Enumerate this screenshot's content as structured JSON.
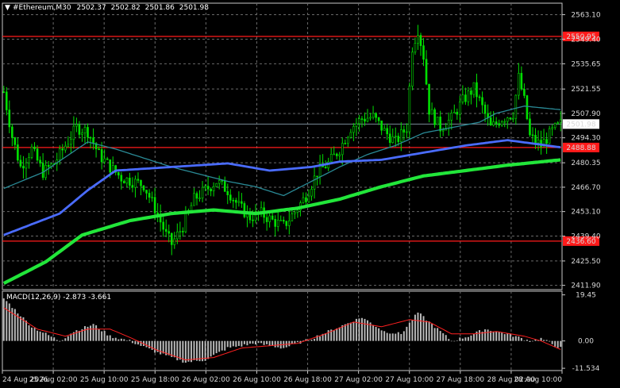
{
  "chart_data": {
    "type": "candlestick",
    "header": {
      "symbol": "#Ethereum,M30",
      "open": "2502.37",
      "high": "2502.82",
      "low": "2501.86",
      "close": "2501.98"
    },
    "y_ticks": [
      "2563.10",
      "2549.40",
      "2535.65",
      "2521.55",
      "2507.90",
      "2494.30",
      "2480.35",
      "2466.70",
      "2453.10",
      "2439.40",
      "2425.50",
      "2411.90"
    ],
    "y_range": [
      2409.5,
      2569.5
    ],
    "x_ticks": [
      "24 Aug 2026",
      "25 Aug 02:00",
      "25 Aug 10:00",
      "25 Aug 18:00",
      "26 Aug 02:00",
      "26 Aug 10:00",
      "26 Aug 18:00",
      "27 Aug 02:00",
      "27 Aug 10:00",
      "27 Aug 18:00",
      "28 Aug 02:00",
      "28 Aug 10:00"
    ],
    "levels": [
      {
        "value": 2550.95,
        "label": "2550.95",
        "color": "#ff1a1a"
      },
      {
        "value": 2488.88,
        "label": "2488.88",
        "color": "#ff1a1a"
      },
      {
        "value": 2436.6,
        "label": "2436.60",
        "color": "#ff1a1a"
      }
    ],
    "current_price": {
      "value": 2501.98,
      "label": "2501.98"
    },
    "price_path": [
      [
        0,
        2520
      ],
      [
        3,
        2495
      ],
      [
        6,
        2478
      ],
      [
        10,
        2488
      ],
      [
        14,
        2475
      ],
      [
        18,
        2480
      ],
      [
        22,
        2490
      ],
      [
        26,
        2500
      ],
      [
        30,
        2498
      ],
      [
        34,
        2485
      ],
      [
        38,
        2478
      ],
      [
        42,
        2472
      ],
      [
        46,
        2470
      ],
      [
        50,
        2468
      ],
      [
        54,
        2455
      ],
      [
        58,
        2440
      ],
      [
        60,
        2435
      ],
      [
        64,
        2445
      ],
      [
        68,
        2460
      ],
      [
        72,
        2465
      ],
      [
        76,
        2470
      ],
      [
        80,
        2465
      ],
      [
        84,
        2456
      ],
      [
        88,
        2450
      ],
      [
        92,
        2452
      ],
      [
        96,
        2448
      ],
      [
        100,
        2445
      ],
      [
        104,
        2453
      ],
      [
        108,
        2462
      ],
      [
        112,
        2475
      ],
      [
        116,
        2480
      ],
      [
        120,
        2488
      ],
      [
        124,
        2500
      ],
      [
        128,
        2505
      ],
      [
        132,
        2506
      ],
      [
        136,
        2498
      ],
      [
        140,
        2492
      ],
      [
        144,
        2500
      ],
      [
        146,
        2545
      ],
      [
        148,
        2555
      ],
      [
        150,
        2540
      ],
      [
        152,
        2510
      ],
      [
        156,
        2500
      ],
      [
        160,
        2505
      ],
      [
        164,
        2515
      ],
      [
        168,
        2522
      ],
      [
        170,
        2515
      ],
      [
        174,
        2500
      ],
      [
        178,
        2505
      ],
      [
        182,
        2508
      ],
      [
        184,
        2528
      ],
      [
        186,
        2515
      ],
      [
        188,
        2495
      ],
      [
        192,
        2490
      ],
      [
        196,
        2498
      ],
      [
        199,
        2502
      ]
    ],
    "ma_fast": [
      [
        0,
        2466
      ],
      [
        14,
        2475
      ],
      [
        30,
        2492
      ],
      [
        40,
        2488
      ],
      [
        60,
        2478
      ],
      [
        80,
        2470
      ],
      [
        90,
        2467
      ],
      [
        100,
        2462
      ],
      [
        110,
        2470
      ],
      [
        120,
        2478
      ],
      [
        130,
        2485
      ],
      [
        140,
        2490
      ],
      [
        150,
        2497
      ],
      [
        160,
        2500
      ],
      [
        170,
        2503
      ],
      [
        176,
        2508
      ],
      [
        186,
        2512
      ],
      [
        199,
        2510
      ]
    ],
    "ma_mid": [
      [
        0,
        2440
      ],
      [
        20,
        2452
      ],
      [
        30,
        2465
      ],
      [
        40,
        2476
      ],
      [
        60,
        2478
      ],
      [
        80,
        2480
      ],
      [
        95,
        2476
      ],
      [
        110,
        2478
      ],
      [
        120,
        2481
      ],
      [
        135,
        2482
      ],
      [
        150,
        2486
      ],
      [
        165,
        2490
      ],
      [
        180,
        2493
      ],
      [
        199,
        2489
      ]
    ],
    "ma_slow": [
      [
        0,
        2413
      ],
      [
        15,
        2425
      ],
      [
        28,
        2440
      ],
      [
        45,
        2448
      ],
      [
        60,
        2452
      ],
      [
        75,
        2454
      ],
      [
        90,
        2452
      ],
      [
        105,
        2455
      ],
      [
        120,
        2460
      ],
      [
        135,
        2467
      ],
      [
        150,
        2473
      ],
      [
        165,
        2476
      ],
      [
        180,
        2479
      ],
      [
        199,
        2482
      ]
    ],
    "macd": {
      "label": "MACD(12,26,9) -2.873 -3.661",
      "y_ticks": [
        "19.45",
        "0.00",
        "-11.534"
      ],
      "range": [
        -12.5,
        21
      ],
      "hist": [
        [
          0,
          18
        ],
        [
          10,
          6
        ],
        [
          20,
          0
        ],
        [
          25,
          4
        ],
        [
          32,
          7
        ],
        [
          38,
          2
        ],
        [
          45,
          0
        ],
        [
          55,
          -5
        ],
        [
          65,
          -9
        ],
        [
          72,
          -8
        ],
        [
          80,
          -3
        ],
        [
          90,
          -1
        ],
        [
          100,
          -3
        ],
        [
          110,
          1
        ],
        [
          118,
          5
        ],
        [
          128,
          10
        ],
        [
          136,
          4
        ],
        [
          142,
          3
        ],
        [
          148,
          12
        ],
        [
          154,
          6
        ],
        [
          160,
          0
        ],
        [
          166,
          2
        ],
        [
          172,
          5
        ],
        [
          180,
          3
        ],
        [
          188,
          0
        ],
        [
          192,
          1
        ],
        [
          199,
          -3
        ]
      ],
      "signal": [
        [
          0,
          14
        ],
        [
          12,
          5
        ],
        [
          22,
          2
        ],
        [
          30,
          5
        ],
        [
          38,
          5
        ],
        [
          46,
          1
        ],
        [
          55,
          -4
        ],
        [
          65,
          -8
        ],
        [
          75,
          -7
        ],
        [
          85,
          -3
        ],
        [
          95,
          -2
        ],
        [
          105,
          -1
        ],
        [
          115,
          3
        ],
        [
          125,
          8
        ],
        [
          135,
          6
        ],
        [
          145,
          9
        ],
        [
          152,
          8
        ],
        [
          160,
          3
        ],
        [
          168,
          3
        ],
        [
          176,
          4
        ],
        [
          186,
          2
        ],
        [
          192,
          0
        ],
        [
          199,
          -3.6
        ]
      ]
    }
  }
}
